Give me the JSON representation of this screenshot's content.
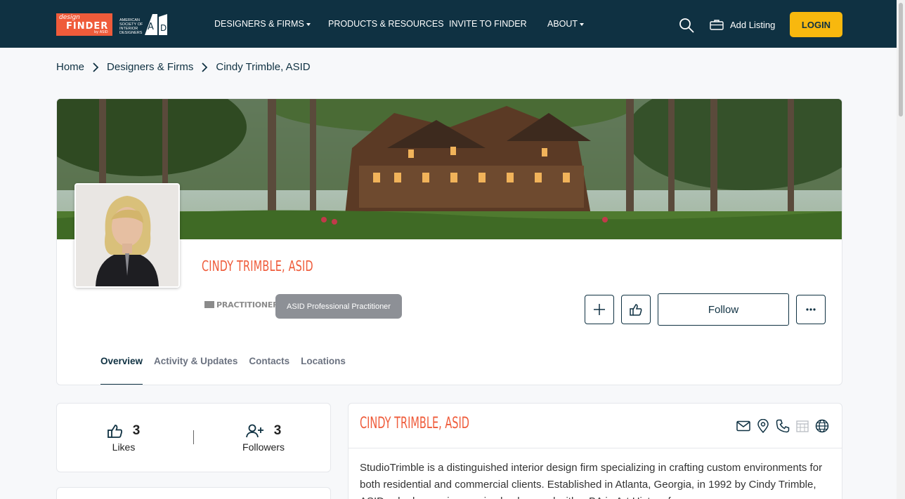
{
  "header": {
    "logo_design_small": "design",
    "logo_finder": "FINDER",
    "logo_by": "by ASID",
    "logo_asid_text": "AMERICAN SOCIETY OF INTERIOR DESIGNERS",
    "nav": [
      {
        "label": "DESIGNERS & FIRMS",
        "dropdown": true
      },
      {
        "label": "PRODUCTS & RESOURCES",
        "dropdown": false
      },
      {
        "label": "INVITE TO FINDER",
        "dropdown": false
      },
      {
        "label": "ABOUT",
        "dropdown": true
      }
    ],
    "add_listing": "Add Listing",
    "login": "LOGIN"
  },
  "breadcrumb": [
    "Home",
    "Designers & Firms",
    "Cindy Trimble, ASID"
  ],
  "profile": {
    "name": "CINDY TRIMBLE, ASID",
    "practitioner_logo_text": "PRACTITIONER",
    "badge": "ASID Professional Practitioner",
    "follow": "Follow",
    "tabs": [
      "Overview",
      "Activity & Updates",
      "Contacts",
      "Locations"
    ],
    "active_tab": "Overview"
  },
  "stats": {
    "likes_count": "3",
    "likes_label": "Likes",
    "followers_count": "3",
    "followers_label": "Followers"
  },
  "about": {
    "title": "CINDY TRIMBLE, ASID",
    "text": "StudioTrimble is a distinguished interior design firm specializing in crafting custom environments for both residential and commercial clients. Established in Atlanta, Georgia, in 1992 by Cindy Trimble, ASID, who has an impressive background with a BA in Art History from"
  },
  "colors": {
    "navy": "#0f3142",
    "accent": "#ef5b3a",
    "login": "#f8b80e"
  },
  "icons": [
    "search-icon",
    "briefcase-icon",
    "chevron-right-icon",
    "plus-icon",
    "thumbs-up-icon",
    "more-icon",
    "user-plus-icon",
    "mail-icon",
    "map-pin-icon",
    "phone-icon",
    "calendar-icon",
    "globe-icon"
  ]
}
